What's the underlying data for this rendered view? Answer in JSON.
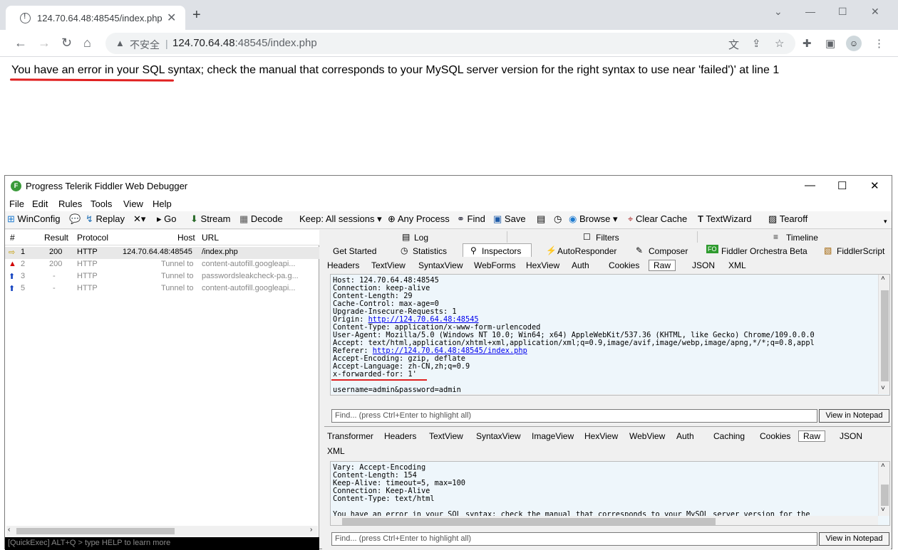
{
  "browser": {
    "tab_title": "124.70.64.48:48545/index.php",
    "new_tab_label": "+",
    "insecure_label": "不安全",
    "url_host": "124.70.64.48",
    "url_path": ":48545/index.php",
    "page_text": "You have an error in your SQL syntax; check the manual that corresponds to your MySQL server version for the right syntax to use near 'failed')' at line 1"
  },
  "fiddler": {
    "title": "Progress Telerik Fiddler Web Debugger",
    "menu": [
      "File",
      "Edit",
      "Rules",
      "Tools",
      "View",
      "Help"
    ],
    "toolbar": {
      "winconfig": "WinConfig",
      "replay": "Replay",
      "go": "Go",
      "stream": "Stream",
      "decode": "Decode",
      "keep": "Keep: All sessions",
      "any_process": "Any Process",
      "find": "Find",
      "save": "Save",
      "browse": "Browse",
      "clear_cache": "Clear Cache",
      "textwizard": "TextWizard",
      "tearoff": "Tearoff"
    },
    "session_columns": [
      "#",
      "Result",
      "Protocol",
      "Host",
      "URL"
    ],
    "sessions": [
      {
        "num": "1",
        "result": "200",
        "protocol": "HTTP",
        "host": "124.70.64.48:48545",
        "url": "/index.php"
      },
      {
        "num": "2",
        "result": "200",
        "protocol": "HTTP",
        "host": "Tunnel to",
        "url": "content-autofill.googleapi..."
      },
      {
        "num": "3",
        "result": "-",
        "protocol": "HTTP",
        "host": "Tunnel to",
        "url": "passwordsleakcheck-pa.g..."
      },
      {
        "num": "5",
        "result": "-",
        "protocol": "HTTP",
        "host": "Tunnel to",
        "url": "content-autofill.googleapi..."
      }
    ],
    "quickexec": "[QuickExec] ALT+Q > type HELP to learn more",
    "top_tabs_row1": {
      "log": "Log",
      "filters": "Filters",
      "timeline": "Timeline"
    },
    "top_tabs_row2": {
      "get_started": "Get Started",
      "statistics": "Statistics",
      "inspectors": "Inspectors",
      "autoresponder": "AutoResponder",
      "composer": "Composer",
      "orchestra": "Fiddler Orchestra Beta",
      "fiddlerscript": "FiddlerScript"
    },
    "request_tabs": [
      "Headers",
      "TextView",
      "SyntaxView",
      "WebForms",
      "HexView",
      "Auth",
      "Cookies",
      "Raw",
      "JSON",
      "XML"
    ],
    "request_raw": {
      "host": "Host: 124.70.64.48:48545",
      "connection": "Connection: keep-alive",
      "content_length": "Content-Length: 29",
      "cache_control": "Cache-Control: max-age=0",
      "upgrade": "Upgrade-Insecure-Requests: 1",
      "origin_label": "Origin: ",
      "origin_url": "http://124.70.64.48:48545",
      "content_type": "Content-Type: application/x-www-form-urlencoded",
      "user_agent": "User-Agent: Mozilla/5.0 (Windows NT 10.0; Win64; x64) AppleWebKit/537.36 (KHTML, like Gecko) Chrome/109.0.0.0",
      "accept": "Accept: text/html,application/xhtml+xml,application/xml;q=0.9,image/avif,image/webp,image/apng,*/*;q=0.8,appl",
      "referer_label": "Referer: ",
      "referer_url": "http://124.70.64.48:48545/index.php",
      "accept_encoding": "Accept-Encoding: gzip, deflate",
      "accept_language": "Accept-Language: zh-CN,zh;q=0.9",
      "x_forwarded_for": "x-forwarded-for: 1'",
      "body": "username=admin&password=admin"
    },
    "find_placeholder": "Find... (press Ctrl+Enter to highlight all)",
    "view_in_notepad": "View in Notepad",
    "response_tabs": [
      "Transformer",
      "Headers",
      "TextView",
      "SyntaxView",
      "ImageView",
      "HexView",
      "WebView",
      "Auth",
      "Caching",
      "Cookies",
      "Raw",
      "JSON"
    ],
    "response_tab_xml": "XML",
    "response_raw": {
      "vary": "Vary: Accept-Encoding",
      "content_length": "Content-Length: 154",
      "keep_alive": "Keep-Alive: timeout=5, max=100",
      "connection": "Connection: Keep-Alive",
      "content_type": "Content-Type: text/html",
      "body": "You have an error in your SQL syntax; check the manual that corresponds to your MySQL server version for the"
    }
  }
}
